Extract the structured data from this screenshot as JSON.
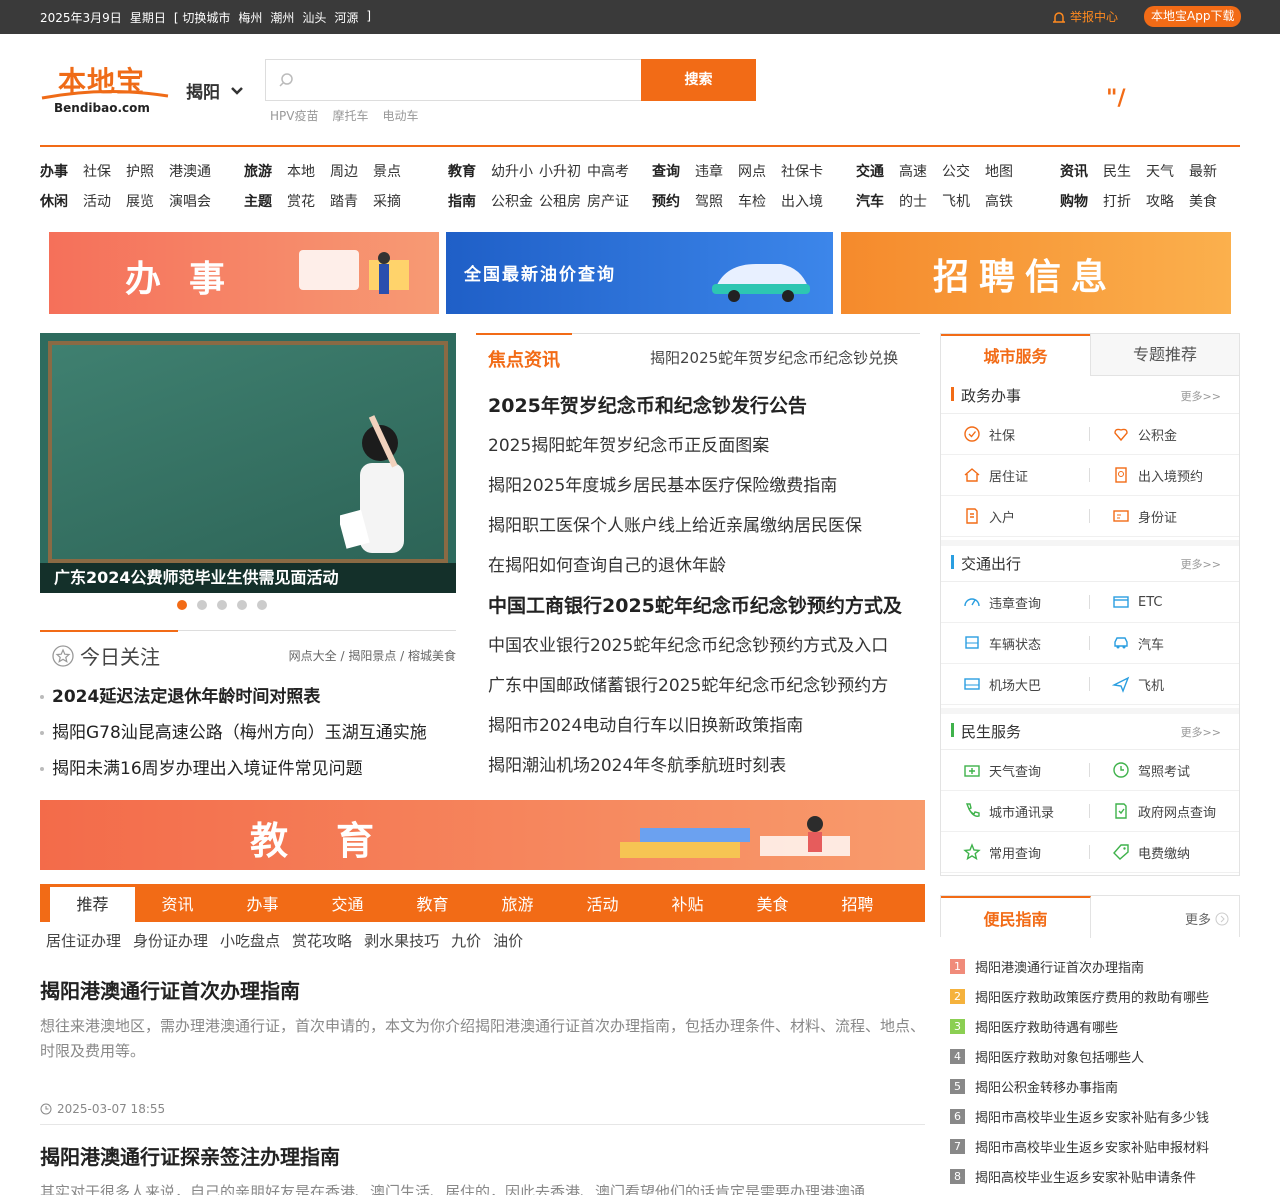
{
  "topbar": {
    "date": "2025年3月9日",
    "weekday": "星期日",
    "switch_label": "[ 切换城市",
    "cities": [
      "梅州",
      "潮州",
      "汕头",
      "河源"
    ],
    "bracket_close": "]",
    "report": "举报中心",
    "app_download": "本地宝App下载"
  },
  "header": {
    "logo_cn": "本地宝",
    "logo_en": "Bendibao.com",
    "city": "揭阳",
    "search_button": "搜索",
    "search_placeholder": "",
    "hotwords": [
      "HPV疫苗",
      "摩托车",
      "电动车"
    ],
    "weather_mark": "\"/"
  },
  "nav": [
    {
      "rows": [
        [
          "办事",
          "社保",
          "护照",
          "港澳通"
        ],
        [
          "休闲",
          "活动",
          "展览",
          "演唱会"
        ]
      ]
    },
    {
      "rows": [
        [
          "旅游",
          "本地",
          "周边",
          "景点"
        ],
        [
          "主题",
          "赏花",
          "踏青",
          "采摘"
        ]
      ]
    },
    {
      "rows": [
        [
          "教育",
          "幼升小",
          "小升初",
          "中高考"
        ],
        [
          "指南",
          "公积金",
          "公租房",
          "房产证"
        ]
      ]
    },
    {
      "rows": [
        [
          "查询",
          "违章",
          "网点",
          "社保卡"
        ],
        [
          "预约",
          "驾照",
          "车检",
          "出入境"
        ]
      ]
    },
    {
      "rows": [
        [
          "交通",
          "高速",
          "公交",
          "地图"
        ],
        [
          "汽车",
          "的士",
          "飞机",
          "高铁"
        ]
      ]
    },
    {
      "rows": [
        [
          "资讯",
          "民生",
          "天气",
          "最新"
        ],
        [
          "购物",
          "打折",
          "攻略",
          "美食"
        ]
      ]
    }
  ],
  "banners": {
    "b1": "办事",
    "b2": "全国最新油价查询",
    "b3": "招聘信息",
    "edu": "教育"
  },
  "slider": {
    "caption": "广东2024公费师范毕业生供需见面活动"
  },
  "today": {
    "title": "今日关注",
    "links": "网点大全 / 揭阳景点 / 榕城美食",
    "items": [
      "2024延迟法定退休年龄时间对照表",
      "揭阳G78汕昆高速公路（梅州方向）玉湖互通实施",
      "揭阳未满16周岁办理出入境证件常见问题"
    ]
  },
  "focus": {
    "title": "焦点资讯",
    "scroll": "揭阳2025蛇年贺岁纪念币纪念钞兑换",
    "items": [
      {
        "text": "2025年贺岁纪念币和纪念钞发行公告",
        "head": true
      },
      {
        "text": "2025揭阳蛇年贺岁纪念币正反面图案",
        "head": false
      },
      {
        "text": "揭阳2025年度城乡居民基本医疗保险缴费指南",
        "head": false
      },
      {
        "text": "揭阳职工医保个人账户线上给近亲属缴纳居民医保",
        "head": false
      },
      {
        "text": "在揭阳如何查询自己的退休年龄",
        "head": false
      },
      {
        "text": "中国工商银行2025蛇年纪念币纪念钞预约方式及",
        "head": true
      },
      {
        "text": "中国农业银行2025蛇年纪念币纪念钞预约方式及入口",
        "head": false
      },
      {
        "text": "广东中国邮政储蓄银行2025蛇年纪念币纪念钞预约方",
        "head": false
      },
      {
        "text": "揭阳市2024电动自行车以旧换新政策指南",
        "head": false
      },
      {
        "text": "揭阳潮汕机场2024年冬航季航班时刻表",
        "head": false
      }
    ]
  },
  "tabs": [
    "推荐",
    "资讯",
    "办事",
    "交通",
    "教育",
    "旅游",
    "活动",
    "补贴",
    "美食",
    "招聘"
  ],
  "subtags": [
    "居住证办理",
    "身份证办理",
    "小吃盘点",
    "赏花攻略",
    "剥水果技巧",
    "九价",
    "油价"
  ],
  "articles": [
    {
      "title": "揭阳港澳通行证首次办理指南",
      "desc": "想往来港澳地区，需办理港澳通行证，首次申请的，本文为你介绍揭阳港澳通行证首次办理指南，包括办理条件、材料、流程、地点、时限及费用等。",
      "time": "2025-03-07 18:55"
    },
    {
      "title": "揭阳港澳通行证探亲签注办理指南",
      "desc": "其实对于很多人来说，自己的亲朋好友是在香港、澳门生活、居住的，因此去香港、澳门看望他们的话肯定是需要办理港澳通"
    }
  ],
  "right": {
    "tab_on": "城市服务",
    "tab_off": "专题推荐",
    "more": "更多>>",
    "sections": [
      {
        "name": "政务办事",
        "color": "#f26b16",
        "items": [
          "社保",
          "公积金",
          "居住证",
          "出入境预约",
          "入户",
          "身份证"
        ]
      },
      {
        "name": "交通出行",
        "color": "#2a9ee0",
        "items": [
          "违章查询",
          "ETC",
          "车辆状态",
          "汽车",
          "机场大巴",
          "飞机"
        ]
      },
      {
        "name": "民生服务",
        "color": "#3fb24b",
        "items": [
          "天气查询",
          "驾照考试",
          "城市通讯录",
          "政府网点查询",
          "常用查询",
          "电费缴纳"
        ]
      }
    ]
  },
  "guide": {
    "title": "便民指南",
    "more": "更多",
    "items": [
      "揭阳港澳通行证首次办理指南",
      "揭阳医疗救助政策医疗费用的救助有哪些",
      "揭阳医疗救助待遇有哪些",
      "揭阳医疗救助对象包括哪些人",
      "揭阳公积金转移办事指南",
      "揭阳市高校毕业生返乡安家补贴有多少钱",
      "揭阳市高校毕业生返乡安家补贴申报材料",
      "揭阳高校毕业生返乡安家补贴申请条件"
    ],
    "colors": [
      "#f08b7a",
      "#f5b23c",
      "#8bcf52",
      "#888888",
      "#888888",
      "#888888",
      "#888888",
      "#888888"
    ]
  },
  "colors": {
    "accent": "#f26b16",
    "topbar": "#3a3a3a"
  }
}
